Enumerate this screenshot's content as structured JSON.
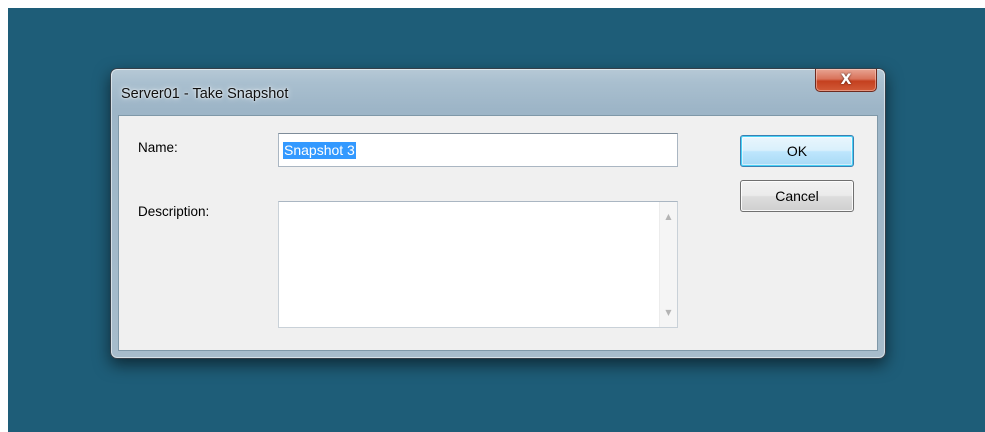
{
  "window": {
    "title": "Server01 - Take Snapshot",
    "close_glyph": "X",
    "close_icon": "close-icon"
  },
  "form": {
    "name_label": "Name:",
    "name_value": "Snapshot 3",
    "description_label": "Description:",
    "description_value": ""
  },
  "buttons": {
    "ok_label": "OK",
    "cancel_label": "Cancel"
  },
  "scrollbar": {
    "up_glyph": "▲",
    "down_glyph": "▼"
  },
  "colors": {
    "desktop": "#1e5d78",
    "selection": "#3399ff",
    "close_button": "#c4401f",
    "dialog_face": "#f0f0f0"
  }
}
